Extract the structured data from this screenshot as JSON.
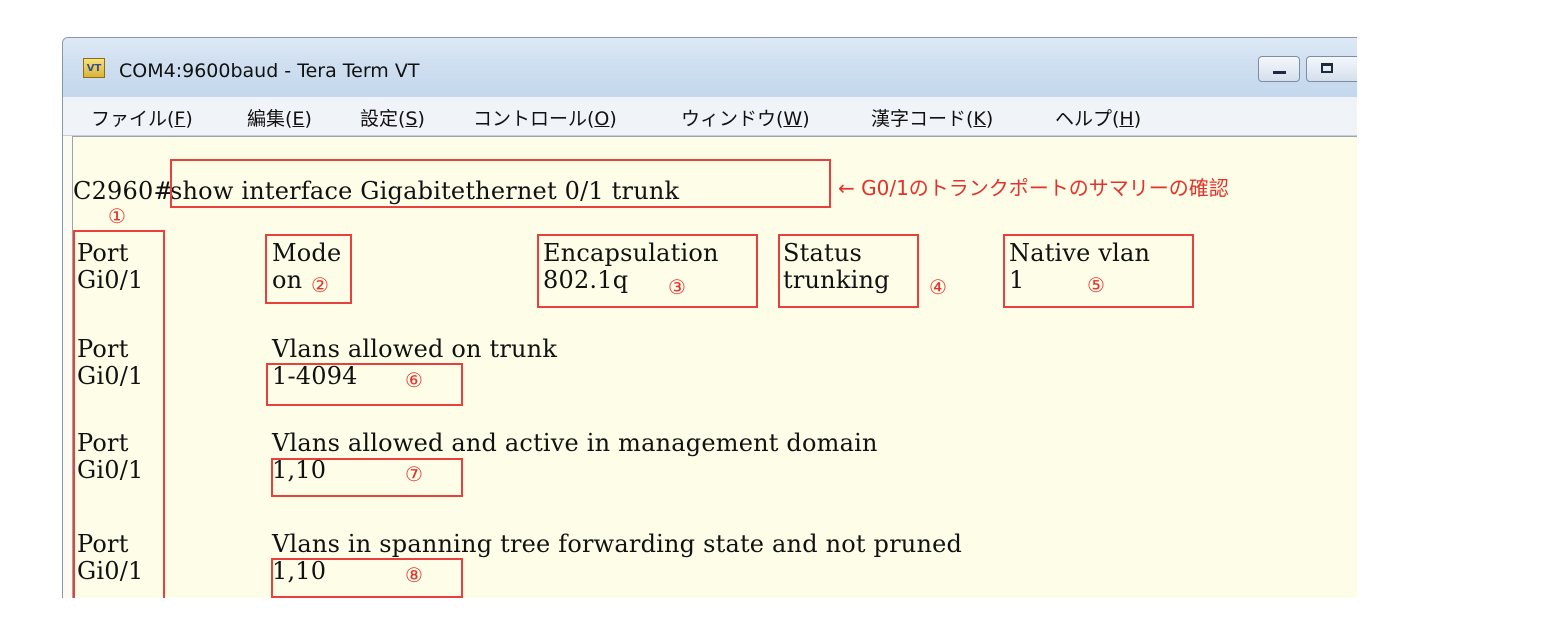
{
  "window": {
    "title": "COM4:9600baud - Tera Term VT",
    "icon": "VT"
  },
  "menu": {
    "items": [
      {
        "label": "ファイル(",
        "key": "F",
        "close": ")"
      },
      {
        "label": "編集(",
        "key": "E",
        "close": ")"
      },
      {
        "label": "設定(",
        "key": "S",
        "close": ")"
      },
      {
        "label": "コントロール(",
        "key": "O",
        "close": ")"
      },
      {
        "label": "ウィンドウ(",
        "key": "W",
        "close": ")"
      },
      {
        "label": "漢字コード(",
        "key": "K",
        "close": ")"
      },
      {
        "label": "ヘルプ(",
        "key": "H",
        "close": ")"
      }
    ]
  },
  "terminal": {
    "prompt": "C2960#",
    "command": "show interface Gigabitethernet 0/1 trunk",
    "rows": {
      "port_header": "Port",
      "port_value": "Gi0/1",
      "mode_header": "Mode",
      "mode_value": "on",
      "encap_header": "Encapsulation",
      "encap_value": "802.1q",
      "status_header": "Status",
      "status_value": "trunking",
      "native_header": "Native vlan",
      "native_value": "1",
      "allowed_header": "Vlans allowed on trunk",
      "allowed_value": "1-4094",
      "active_header": "Vlans allowed and active in management domain",
      "active_value": "1,10",
      "forwarding_header": "Vlans in spanning tree forwarding state and not pruned",
      "forwarding_value": "1,10"
    }
  },
  "annotations": {
    "command_note": "← G0/1のトランクポートのサマリーの確認",
    "markers": [
      "①",
      "②",
      "③",
      "④",
      "⑤",
      "⑥",
      "⑦",
      "⑧"
    ],
    "color": "#e3322c"
  }
}
